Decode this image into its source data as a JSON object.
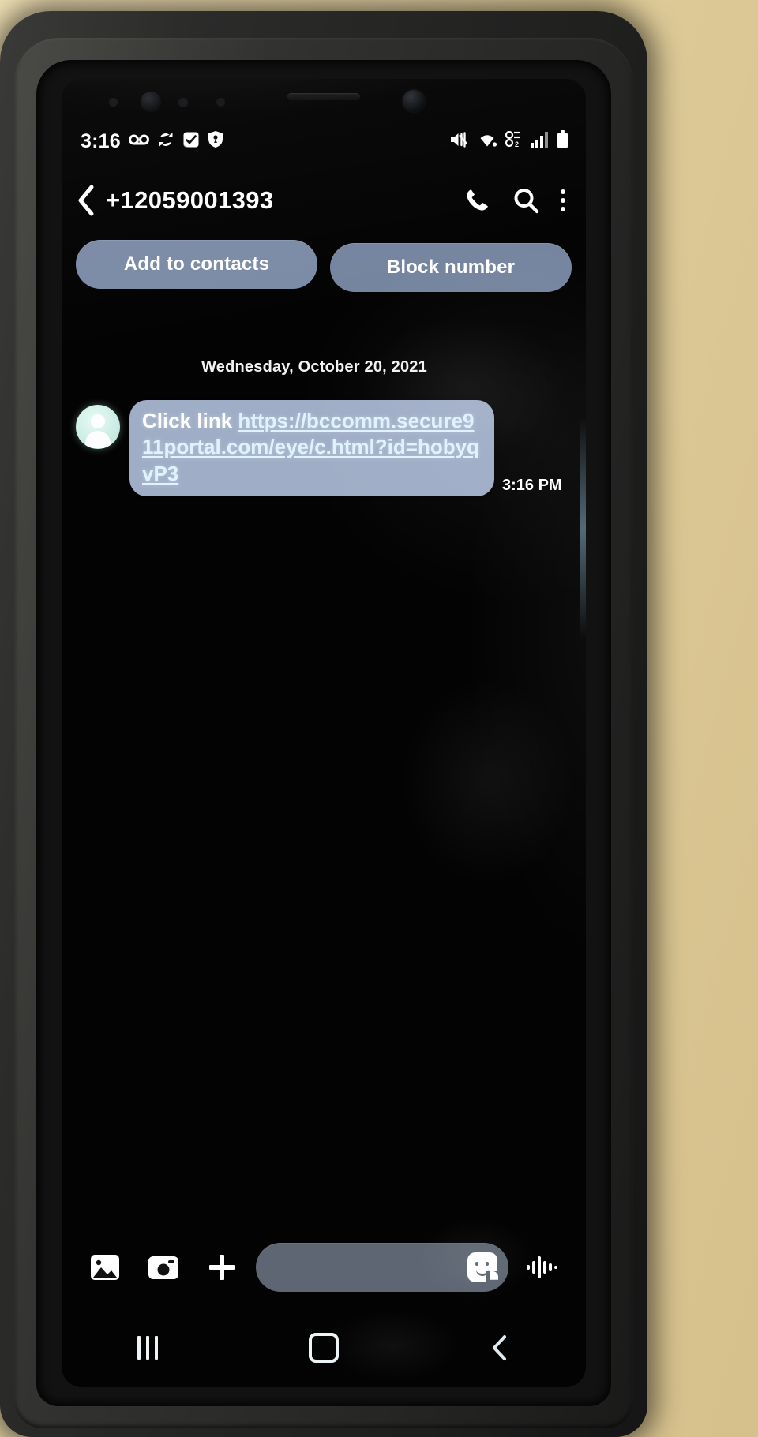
{
  "status_bar": {
    "time": "3:16",
    "left_icons": [
      "voicemail-icon",
      "sync-icon",
      "message-check-icon",
      "shield-icon"
    ],
    "right_icons": [
      "mute-icon",
      "wifi-icon",
      "signal-sim-icon",
      "signal-bars-icon",
      "battery-icon"
    ]
  },
  "header": {
    "back_label": "Back",
    "title": "+12059001393",
    "call_label": "Call",
    "search_label": "Search",
    "more_label": "More options"
  },
  "actions": {
    "add_to_contacts": "Add to contacts",
    "block_number": "Block number"
  },
  "thread": {
    "date_separator": "Wednesday, October 20, 2021",
    "messages": [
      {
        "sender": "incoming",
        "prefix": "Click link ",
        "link": "https://bccomm.secure911portal.com/eye/c.html?id=hobyqvP3",
        "time": "3:16 PM"
      }
    ]
  },
  "compose": {
    "gallery_label": "Gallery",
    "camera_label": "Camera",
    "add_label": "Add attachment",
    "input_placeholder": "",
    "input_value": "",
    "sticker_label": "Stickers",
    "voice_label": "Voice recording"
  },
  "nav_bar": {
    "recents_label": "Recents",
    "home_label": "Home",
    "back_label": "Back"
  },
  "colors": {
    "chip_bg": "#7c8ba6",
    "bubble_bg": "#9fadc6",
    "link_text": "#dff3ff",
    "input_bg": "#5d6672",
    "screen_bg": "#030303"
  }
}
